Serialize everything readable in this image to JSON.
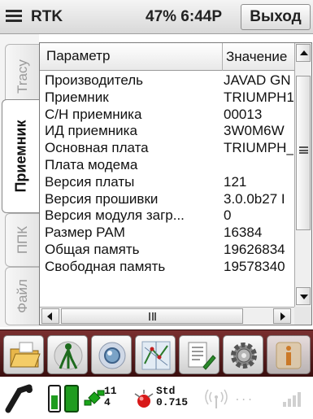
{
  "titlebar": {
    "title": "RTK",
    "status": "47% 6:44P",
    "exit_label": "Выход"
  },
  "side_tabs": [
    {
      "label": "Tracy",
      "active": false
    },
    {
      "label": "Приемник",
      "active": true
    },
    {
      "label": "ППК",
      "active": false
    },
    {
      "label": "Файл",
      "active": false
    }
  ],
  "table": {
    "columns": [
      "Параметр",
      "Значение"
    ],
    "rows": [
      {
        "param": "Производитель",
        "value": "JAVAD GN"
      },
      {
        "param": "Приемник",
        "value": "TRIUMPH1"
      },
      {
        "param": "С/Н приемника",
        "value": "00013"
      },
      {
        "param": "ИД приемника",
        "value": "3W0M6W"
      },
      {
        "param": "Основная плата",
        "value": "TRIUMPH_"
      },
      {
        "param": "Плата модема",
        "value": ""
      },
      {
        "param": "Версия платы",
        "value": "121"
      },
      {
        "param": "Версия прошивки",
        "value": "3.0.0b27 I"
      },
      {
        "param": "Версия модуля загр...",
        "value": "0"
      },
      {
        "param": "Размер РАМ",
        "value": "16384"
      },
      {
        "param": "Общая память",
        "value": "19626834"
      },
      {
        "param": "Свободная память",
        "value": "19578340"
      }
    ]
  },
  "toolbar": {
    "tools": [
      "folder-icon",
      "survey-icon",
      "search-icon",
      "map-icon",
      "edit-doc-icon",
      "settings-icon",
      "info-icon"
    ]
  },
  "statusbar": {
    "satellites_top": "11",
    "satellites_bottom": "4",
    "std_label": "Std",
    "std_value": "0.715",
    "link_dots": "...",
    "colors": {
      "battery": "#1f9c1f",
      "satellite": "#1aa51a",
      "fix": "#d81818"
    }
  }
}
